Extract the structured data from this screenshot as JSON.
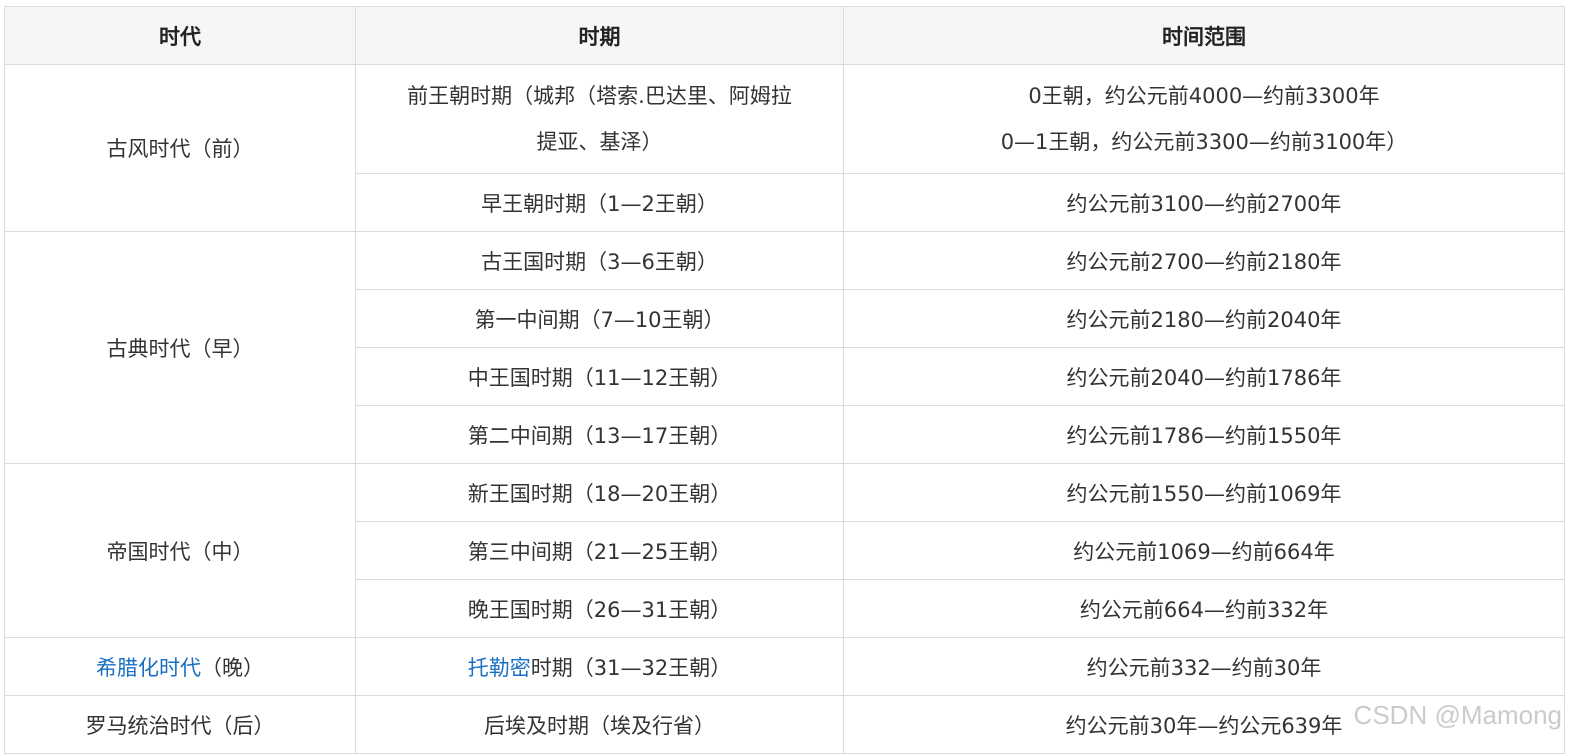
{
  "headers": [
    "时代",
    "时期",
    "时间范围"
  ],
  "eras": [
    {
      "name": "古风时代（前）"
    },
    {
      "name": "古典时代（早）"
    },
    {
      "name": "帝国时代（中）"
    },
    {
      "name_link": "希腊化时代",
      "name_suffix": "（晚）"
    },
    {
      "name": "罗马统治时代（后）"
    }
  ],
  "rows": [
    {
      "period_lines": [
        "前王朝时期（城邦（塔索.巴达里、阿姆拉",
        "提亚、基泽）"
      ],
      "range_lines": [
        "0王朝，约公元前4000—约前3300年",
        "0—1王朝，约公元前3300—约前3100年）"
      ]
    },
    {
      "period": "早王朝时期（1—2王朝）",
      "range": "约公元前3100—约前2700年"
    },
    {
      "period": "古王国时期（3—6王朝）",
      "range": "约公元前2700—约前2180年"
    },
    {
      "period": "第一中间期（7—10王朝）",
      "range": "约公元前2180—约前2040年"
    },
    {
      "period": "中王国时期（11—12王朝）",
      "range": "约公元前2040—约前1786年"
    },
    {
      "period": "第二中间期（13—17王朝）",
      "range": "约公元前1786—约前1550年"
    },
    {
      "period": "新王国时期（18—20王朝）",
      "range": "约公元前1550—约前1069年"
    },
    {
      "period": "第三中间期（21—25王朝）",
      "range": "约公元前1069—约前664年"
    },
    {
      "period": "晚王国时期（26—31王朝）",
      "range": "约公元前664—约前332年"
    },
    {
      "period_link": "托勒密",
      "period_suffix": "时期（31—32王朝）",
      "range": "约公元前332—约前30年"
    },
    {
      "period": "后埃及时期（埃及行省）",
      "range": "约公元前30年—约公元639年"
    }
  ],
  "watermark": "CSDN @Mamong"
}
